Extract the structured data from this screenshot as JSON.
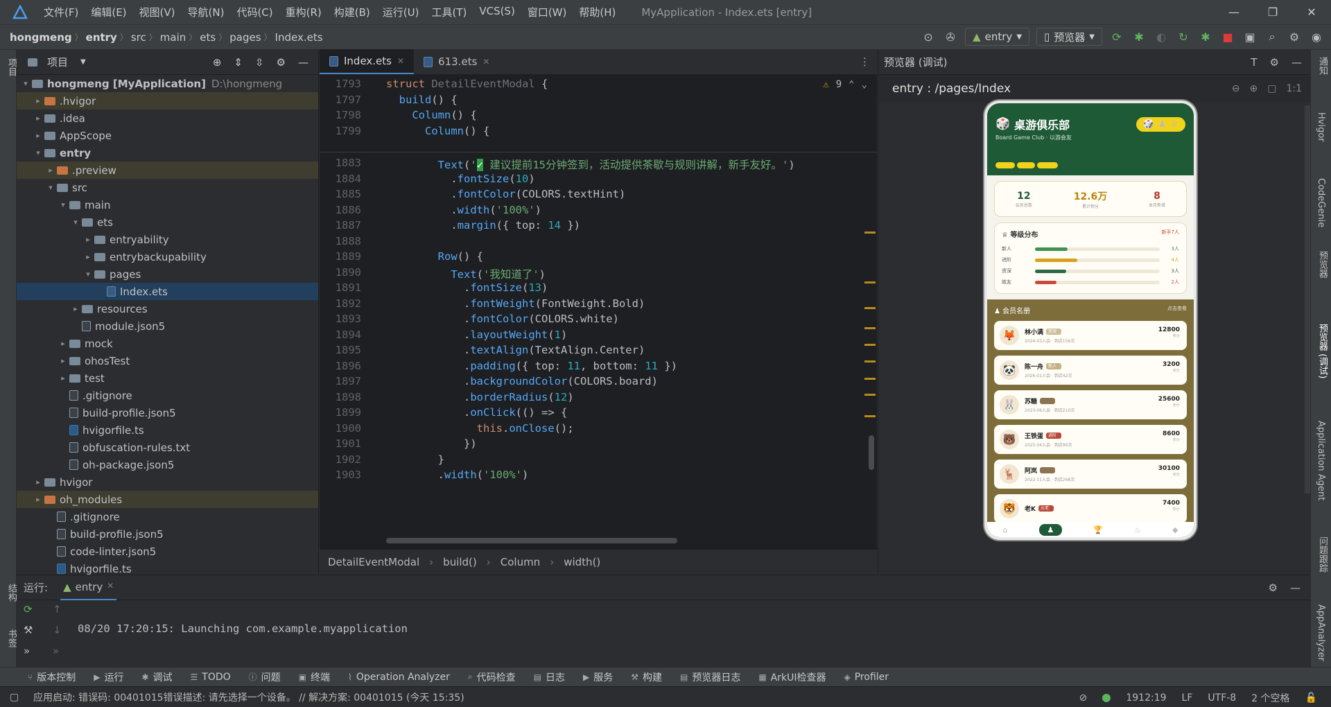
{
  "app": {
    "window_title": "MyApplication - Index.ets [entry]",
    "menu": [
      "文件(F)",
      "编辑(E)",
      "视图(V)",
      "导航(N)",
      "代码(C)",
      "重构(R)",
      "构建(B)",
      "运行(U)",
      "工具(T)",
      "VCS(S)",
      "窗口(W)",
      "帮助(H)"
    ]
  },
  "breadcrumb": [
    "hongmeng",
    "entry",
    "src",
    "main",
    "ets",
    "pages",
    "Index.ets"
  ],
  "toolbar": {
    "config": "entry",
    "device": "预览器"
  },
  "project": {
    "title": "项目",
    "tree": [
      {
        "label": "hongmeng [MyApplication]",
        "extra": "D:\\hongmeng",
        "depth": 0,
        "arrow": "▾",
        "icon": "folder"
      },
      {
        "label": ".hvigor",
        "depth": 1,
        "arrow": "▸",
        "icon": "folder-orange",
        "hl": true
      },
      {
        "label": ".idea",
        "depth": 1,
        "arrow": "▸",
        "icon": "folder"
      },
      {
        "label": "AppScope",
        "depth": 1,
        "arrow": "▸",
        "icon": "folder"
      },
      {
        "label": "entry",
        "depth": 1,
        "arrow": "▾",
        "icon": "folder",
        "bold": true
      },
      {
        "label": ".preview",
        "depth": 2,
        "arrow": "▸",
        "icon": "folder-orange",
        "hl": true
      },
      {
        "label": "src",
        "depth": 2,
        "arrow": "▾",
        "icon": "folder"
      },
      {
        "label": "main",
        "depth": 3,
        "arrow": "▾",
        "icon": "folder"
      },
      {
        "label": "ets",
        "depth": 4,
        "arrow": "▾",
        "icon": "folder"
      },
      {
        "label": "entryability",
        "depth": 5,
        "arrow": "▸",
        "icon": "folder"
      },
      {
        "label": "entrybackupability",
        "depth": 5,
        "arrow": "▸",
        "icon": "folder"
      },
      {
        "label": "pages",
        "depth": 5,
        "arrow": "▾",
        "icon": "folder"
      },
      {
        "label": "Index.ets",
        "depth": 6,
        "arrow": "",
        "icon": "ets",
        "sel": true
      },
      {
        "label": "resources",
        "depth": 4,
        "arrow": "▸",
        "icon": "folder"
      },
      {
        "label": "module.json5",
        "depth": 4,
        "arrow": "",
        "icon": "file"
      },
      {
        "label": "mock",
        "depth": 3,
        "arrow": "▸",
        "icon": "folder"
      },
      {
        "label": "ohosTest",
        "depth": 3,
        "arrow": "▸",
        "icon": "folder"
      },
      {
        "label": "test",
        "depth": 3,
        "arrow": "▸",
        "icon": "folder"
      },
      {
        "label": ".gitignore",
        "depth": 3,
        "arrow": "",
        "icon": "file"
      },
      {
        "label": "build-profile.json5",
        "depth": 3,
        "arrow": "",
        "icon": "file"
      },
      {
        "label": "hvigorfile.ts",
        "depth": 3,
        "arrow": "",
        "icon": "ts"
      },
      {
        "label": "obfuscation-rules.txt",
        "depth": 3,
        "arrow": "",
        "icon": "file"
      },
      {
        "label": "oh-package.json5",
        "depth": 3,
        "arrow": "",
        "icon": "file"
      },
      {
        "label": "hvigor",
        "depth": 1,
        "arrow": "▸",
        "icon": "folder"
      },
      {
        "label": "oh_modules",
        "depth": 1,
        "arrow": "▸",
        "icon": "folder-orange",
        "hl": true
      },
      {
        "label": ".gitignore",
        "depth": 2,
        "arrow": "",
        "icon": "file"
      },
      {
        "label": "build-profile.json5",
        "depth": 2,
        "arrow": "",
        "icon": "file"
      },
      {
        "label": "code-linter.json5",
        "depth": 2,
        "arrow": "",
        "icon": "file"
      },
      {
        "label": "hvigorfile.ts",
        "depth": 2,
        "arrow": "",
        "icon": "ts"
      }
    ]
  },
  "editor": {
    "tabs": [
      {
        "label": "Index.ets",
        "active": true
      },
      {
        "label": "613.ets",
        "active": false
      }
    ],
    "warnings": "9",
    "sticky": [
      {
        "n": "1793",
        "html": "<span class='kw'>struct</span> <span class='dim'>DetailEventModal</span> {"
      },
      {
        "n": "1797",
        "html": "  <span class='fn'>build</span>() {"
      },
      {
        "n": "1798",
        "html": "    <span class='fn'>Column</span>() {"
      },
      {
        "n": "1799",
        "html": "      <span class='fn'>Column</span>() {"
      }
    ],
    "lines": [
      {
        "n": "1883",
        "html": "        <span class='fn'>Text</span>(<span class='st'>'</span><span style='background:#2f9e44;color:#fff'>✓</span><span class='st'> 建议提前15分钟签到，活动提供茶歇与规则讲解，新手友好。'</span>)"
      },
      {
        "n": "1884",
        "html": "          .<span class='fn'>fontSize</span>(<span class='nm'>10</span>)"
      },
      {
        "n": "1885",
        "html": "          .<span class='fn'>fontColor</span>(COLORS.textHint)"
      },
      {
        "n": "1886",
        "html": "          .<span class='fn'>width</span>(<span class='st'>'100%'</span>)"
      },
      {
        "n": "1887",
        "html": "          .<span class='fn'>margin</span>({ top: <span class='nm'>14</span> })"
      },
      {
        "n": "1888",
        "html": ""
      },
      {
        "n": "1889",
        "html": "        <span class='fn'>Row</span>() {"
      },
      {
        "n": "1890",
        "html": "          <span class='fn'>Text</span>(<span class='st'>'我知道了'</span>)"
      },
      {
        "n": "1891",
        "html": "            .<span class='fn'>fontSize</span>(<span class='nm'>13</span>)"
      },
      {
        "n": "1892",
        "html": "            .<span class='fn'>fontWeight</span>(FontWeight.Bold)"
      },
      {
        "n": "1893",
        "html": "            .<span class='fn'>fontColor</span>(COLORS.white)"
      },
      {
        "n": "1894",
        "html": "            .<span class='fn'>layoutWeight</span>(<span class='nm'>1</span>)"
      },
      {
        "n": "1895",
        "html": "            .<span class='fn'>textAlign</span>(TextAlign.Center)"
      },
      {
        "n": "1896",
        "html": "            .<span class='fn'>padding</span>({ top: <span class='nm'>11</span>, bottom: <span class='nm'>11</span> })"
      },
      {
        "n": "1897",
        "html": "            .<span class='fn'>backgroundColor</span>(COLORS.board)"
      },
      {
        "n": "1898",
        "html": "            .<span class='fn'>borderRadius</span>(<span class='nm'>12</span>)"
      },
      {
        "n": "1899",
        "html": "            .<span class='fn'>onClick</span>(() => {"
      },
      {
        "n": "1900",
        "html": "              <span class='kw'>this</span>.<span class='fn'>onClose</span>();"
      },
      {
        "n": "1901",
        "html": "            })"
      },
      {
        "n": "1902",
        "html": "        }"
      },
      {
        "n": "1903",
        "html": "        .<span class='fn'>width</span>(<span class='st'>'100%'</span>)"
      }
    ],
    "breadcrumb": [
      "DetailEventModal",
      "build()",
      "Column",
      "width()"
    ]
  },
  "preview": {
    "title": "预览器 (调试)",
    "route": "entry : /pages/Index",
    "app": {
      "header_title": "桌游俱乐部",
      "header_sub": "Board Game Club · 以游会友",
      "stats": [
        {
          "v": "12",
          "l": "会员总数"
        },
        {
          "v": "12.6万",
          "l": "累计积分"
        },
        {
          "v": "8",
          "l": "本月新增"
        }
      ],
      "levels_title": "等级分布",
      "levels_right": "新手7人",
      "levels": [
        {
          "name": "新人",
          "count": "3人",
          "pct": 0.26,
          "color": "#3f8f4f"
        },
        {
          "name": "进阶",
          "count": "4人",
          "pct": 0.34,
          "color": "#d8a11a"
        },
        {
          "name": "资深",
          "count": "3人",
          "pct": 0.25,
          "color": "#2d6b45"
        },
        {
          "name": "故友",
          "count": "2人",
          "pct": 0.17,
          "color": "#c94a3b"
        }
      ],
      "members_title": "会员名册",
      "members_right": "点击查看",
      "members": [
        {
          "name": "林小满",
          "tag": "资深",
          "sub": "2024-03入会 · 到店156次",
          "score": "12800",
          "avatar": "🦊",
          "tagc": "#cbbf9a"
        },
        {
          "name": "陈一舟",
          "tag": "新人",
          "sub": "2026-01入会 · 到店42次",
          "score": "3200",
          "avatar": "🐼",
          "tagc": "#c5b184"
        },
        {
          "name": "苏糖",
          "tag": "",
          "sub": "2023-06入会 · 到店210次",
          "score": "25600",
          "avatar": "🐰",
          "tagc": "#8a7451"
        },
        {
          "name": "王铁蛋",
          "tag": "进阶",
          "sub": "2025-04入会 · 到店96次",
          "score": "8600",
          "avatar": "🐻",
          "tagc": "#b9473a"
        },
        {
          "name": "阿岚",
          "tag": "",
          "sub": "2022-11入会 · 到店268次",
          "score": "30100",
          "avatar": "🦌",
          "tagc": "#8a7451"
        },
        {
          "name": "老K",
          "tag": "元老",
          "sub": "",
          "score": "7400",
          "avatar": "🐯",
          "tagc": "#b9473a"
        }
      ],
      "score_unit": "积分"
    }
  },
  "run": {
    "label": "运行:",
    "tab": "entry",
    "log": "08/20 17:20:15: Launching com.example.myapplication"
  },
  "bottom_tools": [
    "版本控制",
    "运行",
    "调试",
    "TODO",
    "问题",
    "终端",
    "Operation Analyzer",
    "代码检查",
    "日志",
    "服务",
    "构建",
    "预览器日志",
    "ArkUI检查器",
    "Profiler"
  ],
  "status": {
    "msg": "应用启动: 错误码: 00401015错误描述: 请先选择一个设备。 // 解决方案: 00401015 (今天 15:35)",
    "pos": "1912:19",
    "le": "LF",
    "enc": "UTF-8",
    "indent": "2 个空格"
  },
  "right_tools": [
    "通知",
    "Hvigor",
    "CodeGenie",
    "预览器",
    "预览器 (调试)",
    "Application Agent",
    "问题跟踪",
    "AppAnalyzer"
  ],
  "left_tools": [
    "项目",
    "结构",
    "书签"
  ]
}
